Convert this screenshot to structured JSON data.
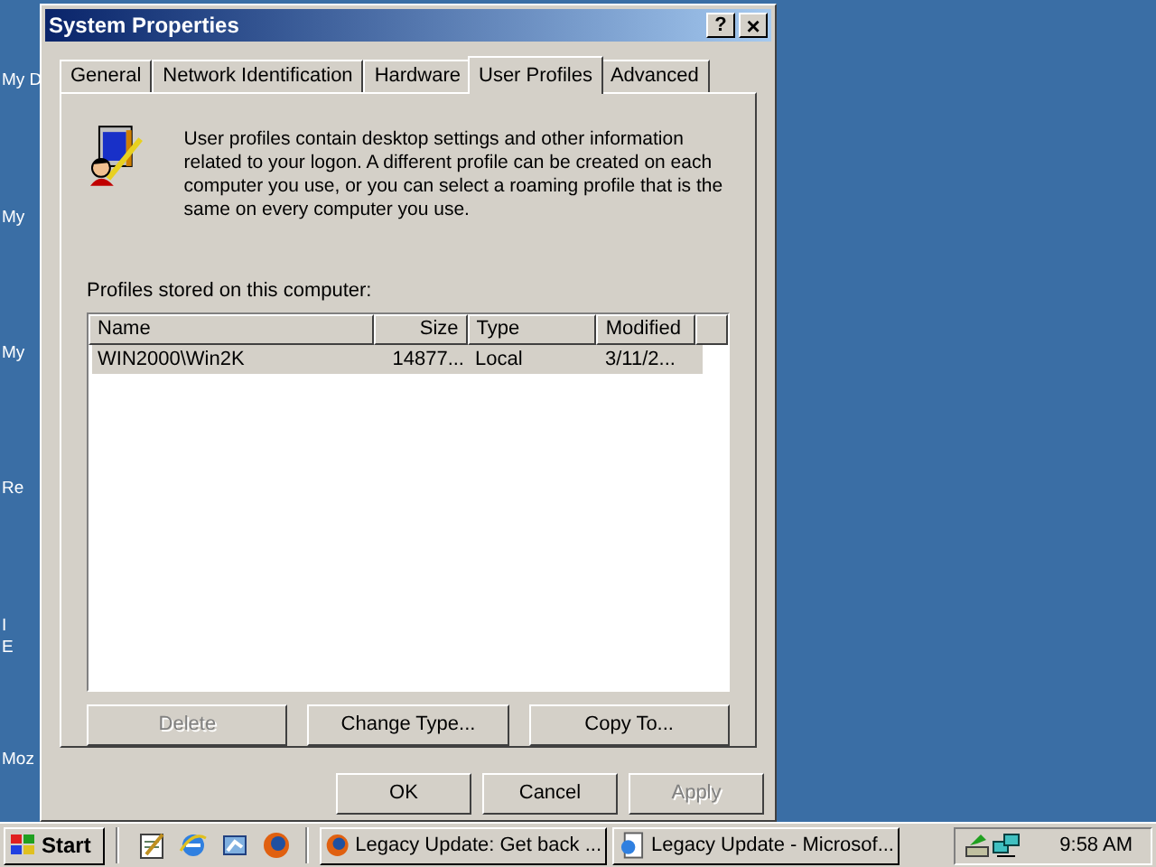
{
  "desktop_icons": [
    {
      "label": "My D"
    },
    {
      "label": "My"
    },
    {
      "label": "My"
    },
    {
      "label": "Re"
    },
    {
      "label": "I"
    },
    {
      "label": "E"
    },
    {
      "label": "Moz"
    }
  ],
  "window": {
    "title": "System Properties",
    "help": "?",
    "close": "×"
  },
  "tabs": [
    {
      "label": "General",
      "selected": false
    },
    {
      "label": "Network Identification",
      "selected": false
    },
    {
      "label": "Hardware",
      "selected": false
    },
    {
      "label": "User Profiles",
      "selected": true
    },
    {
      "label": "Advanced",
      "selected": false
    }
  ],
  "description": "User profiles contain desktop settings and other information related to your logon.  A different profile can be created on each computer you use, or you can select a roaming profile that is the same on every computer you use.",
  "list_label": "Profiles stored on this computer:",
  "columns": [
    "Name",
    "Size",
    "Type",
    "Modified"
  ],
  "rows": [
    {
      "cells": [
        "WIN2000\\Win2K",
        "14877...",
        "Local",
        "3/11/2..."
      ],
      "selected": true
    }
  ],
  "buttons": [
    {
      "label": "Delete",
      "disabled": true
    },
    {
      "label": "Change Type...",
      "disabled": false
    },
    {
      "label": "Copy To...",
      "disabled": false
    }
  ],
  "dialog_buttons": [
    {
      "label": "OK",
      "disabled": false
    },
    {
      "label": "Cancel",
      "disabled": false
    },
    {
      "label": "Apply",
      "disabled": true
    }
  ],
  "taskbar": {
    "start": "Start",
    "tasks": [
      {
        "label": "Legacy Update: Get back ...",
        "kind": "firefox"
      },
      {
        "label": "Legacy Update - Microsof...",
        "kind": "ie"
      }
    ],
    "clock": "9:58 AM"
  }
}
